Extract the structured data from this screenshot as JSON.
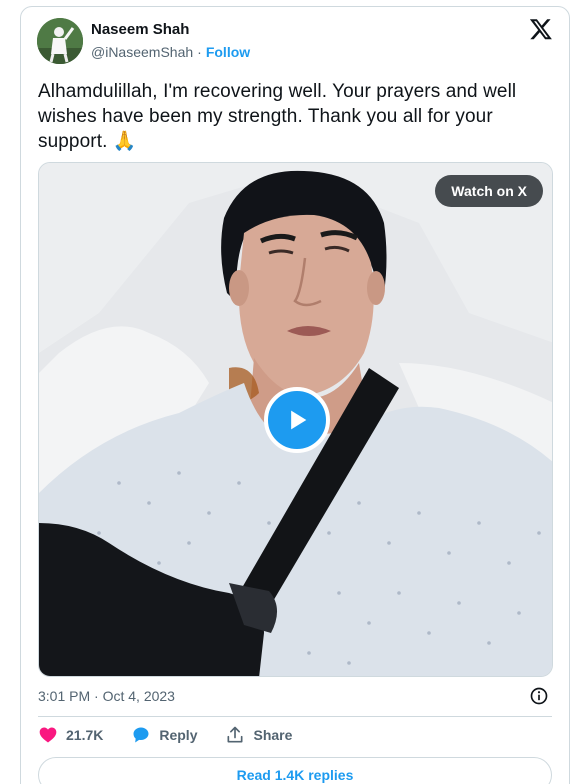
{
  "author": {
    "name": "Naseem Shah",
    "handle": "@iNaseemShah",
    "separator": "·",
    "follow_label": "Follow"
  },
  "tweet": {
    "text": "Alhamdulillah, I'm recovering well. Your prayers and well wishes have been my strength. Thank you all for your support. 🙏"
  },
  "media": {
    "watch_label": "Watch on X"
  },
  "meta": {
    "timestamp": "3:01 PM · Oct 4, 2023"
  },
  "actions": {
    "likes": "21.7K",
    "reply_label": "Reply",
    "share_label": "Share"
  },
  "replies_button": "Read 1.4K replies",
  "colors": {
    "accent": "#1d9bf0",
    "like": "#f91880",
    "muted": "#536471"
  },
  "icons": [
    "x-logo-icon",
    "play-icon",
    "info-icon",
    "heart-icon",
    "reply-bubble-icon",
    "share-icon"
  ]
}
